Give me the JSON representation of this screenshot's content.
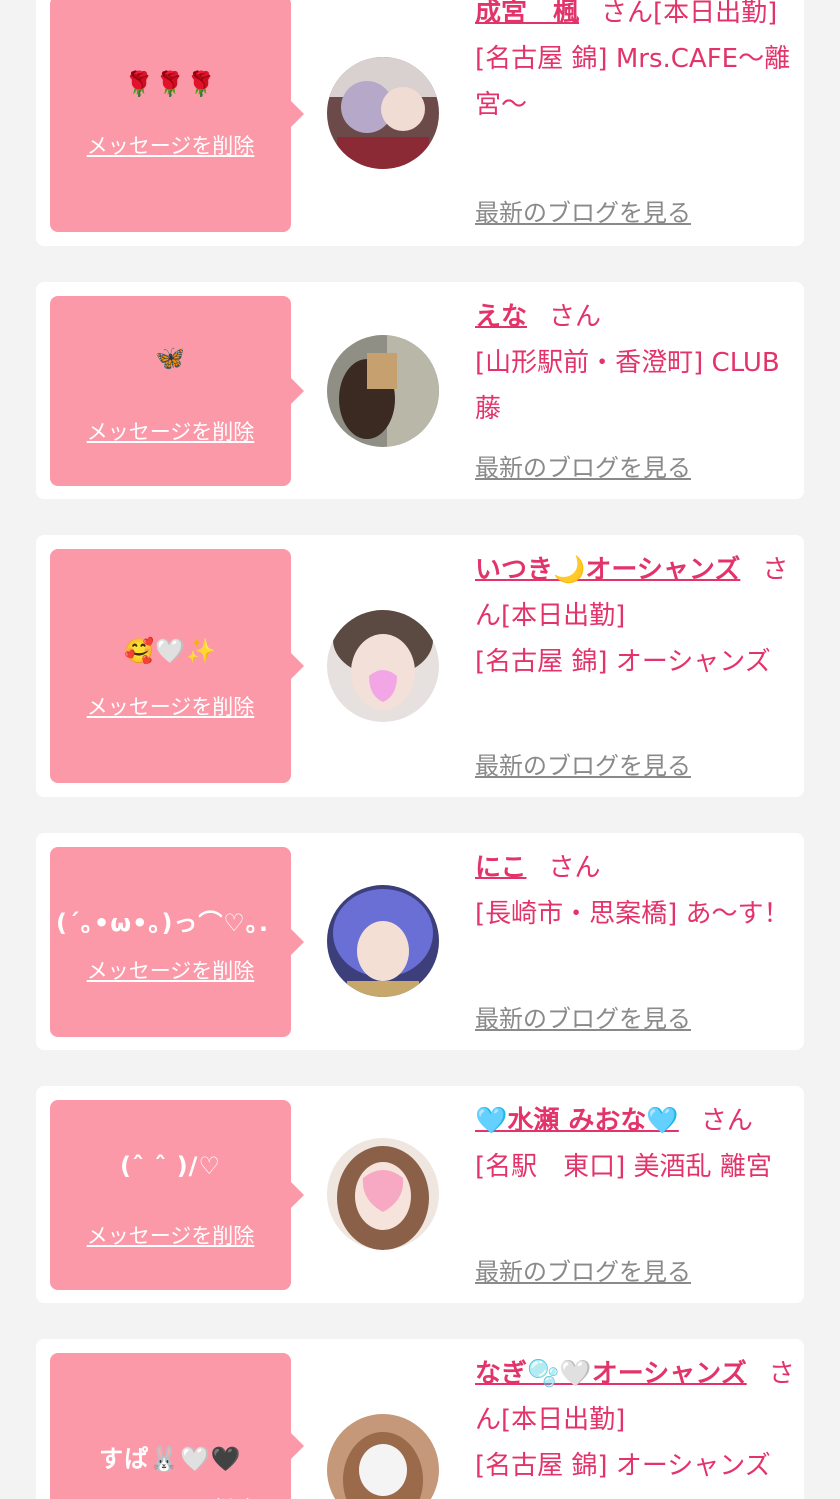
{
  "delete_label": "メッセージを削除",
  "blog_label": "最新のブログを見る",
  "san_label": "さん",
  "colors": {
    "background": "#f3f3f3",
    "card": "#ffffff",
    "bubble": "#fb99a8",
    "accent_text": "#e3336b",
    "link_gray": "#8a8a8a"
  },
  "cards": [
    {
      "message": "🌹🌹🌹",
      "name": "成宮　楓",
      "status": "[本日出勤]",
      "shop": "[名古屋 錦] Mrs.CAFE〜離宮〜",
      "avatar": "avatar-photo"
    },
    {
      "message": "🦋",
      "name": "えな",
      "status": "",
      "shop": "[山形駅前・香澄町] CLUB 藤",
      "avatar": "avatar-photo"
    },
    {
      "message": "🥰🤍✨",
      "name": "いつき🌙オーシャンズ",
      "status": "[本日出勤]",
      "shop": "[名古屋 錦] オーシャンズ",
      "avatar": "avatar-photo"
    },
    {
      "message": "(´｡•ω•｡)っ⌒♡｡.",
      "name": "にこ",
      "status": "",
      "shop": "[長崎市・思案橋] あ〜す！",
      "avatar": "avatar-photo"
    },
    {
      "message": "(ˆ ˆ )/♡",
      "name": "🩵水瀬 みおな🩵",
      "status": "",
      "shop": "[名駅　東口] 美酒乱 離宮",
      "avatar": "avatar-photo"
    },
    {
      "message": "すぱ🐰🤍🖤",
      "name": "なぎ🫧🤍オーシャンズ",
      "status": "[本日出勤]",
      "shop": "[名古屋 錦] オーシャンズ",
      "avatar": "avatar-photo"
    }
  ]
}
